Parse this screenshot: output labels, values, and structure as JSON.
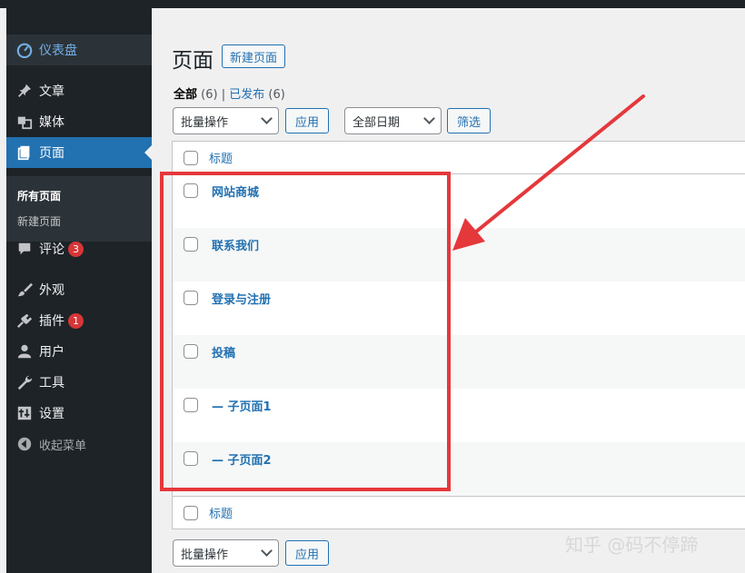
{
  "sidebar": {
    "dashboard": "仪表盘",
    "items": [
      {
        "label": "文章",
        "icon": "pin-icon"
      },
      {
        "label": "媒体",
        "icon": "media-icon"
      },
      {
        "label": "页面",
        "icon": "page-icon"
      },
      {
        "label": "评论",
        "icon": "comment-icon",
        "badge": "3"
      },
      {
        "label": "外观",
        "icon": "brush-icon"
      },
      {
        "label": "插件",
        "icon": "plugin-icon",
        "badge": "1"
      },
      {
        "label": "用户",
        "icon": "user-icon"
      },
      {
        "label": "工具",
        "icon": "wrench-icon"
      },
      {
        "label": "设置",
        "icon": "settings-icon"
      }
    ],
    "submenu": [
      "所有页面",
      "新建页面"
    ],
    "collapse": "收起菜单"
  },
  "main": {
    "title": "页面",
    "add_new": "新建页面",
    "filters": {
      "all_label": "全部",
      "all_count": "(6)",
      "separator": "|",
      "published_label": "已发布",
      "published_count": "(6)"
    },
    "bulk_select": "批量操作",
    "apply": "应用",
    "date_select": "全部日期",
    "filter_button": "筛选",
    "column_title": "标题",
    "rows": [
      "网站商城",
      "联系我们",
      "登录与注册",
      "投稿",
      "— 子页面1",
      "— 子页面2"
    ]
  },
  "watermark": "知乎 @码不停蹄",
  "colors": {
    "sidebar_bg": "#1d2327",
    "accent": "#2271b1",
    "highlight_box": "#e5383b",
    "badge": "#d63638"
  }
}
